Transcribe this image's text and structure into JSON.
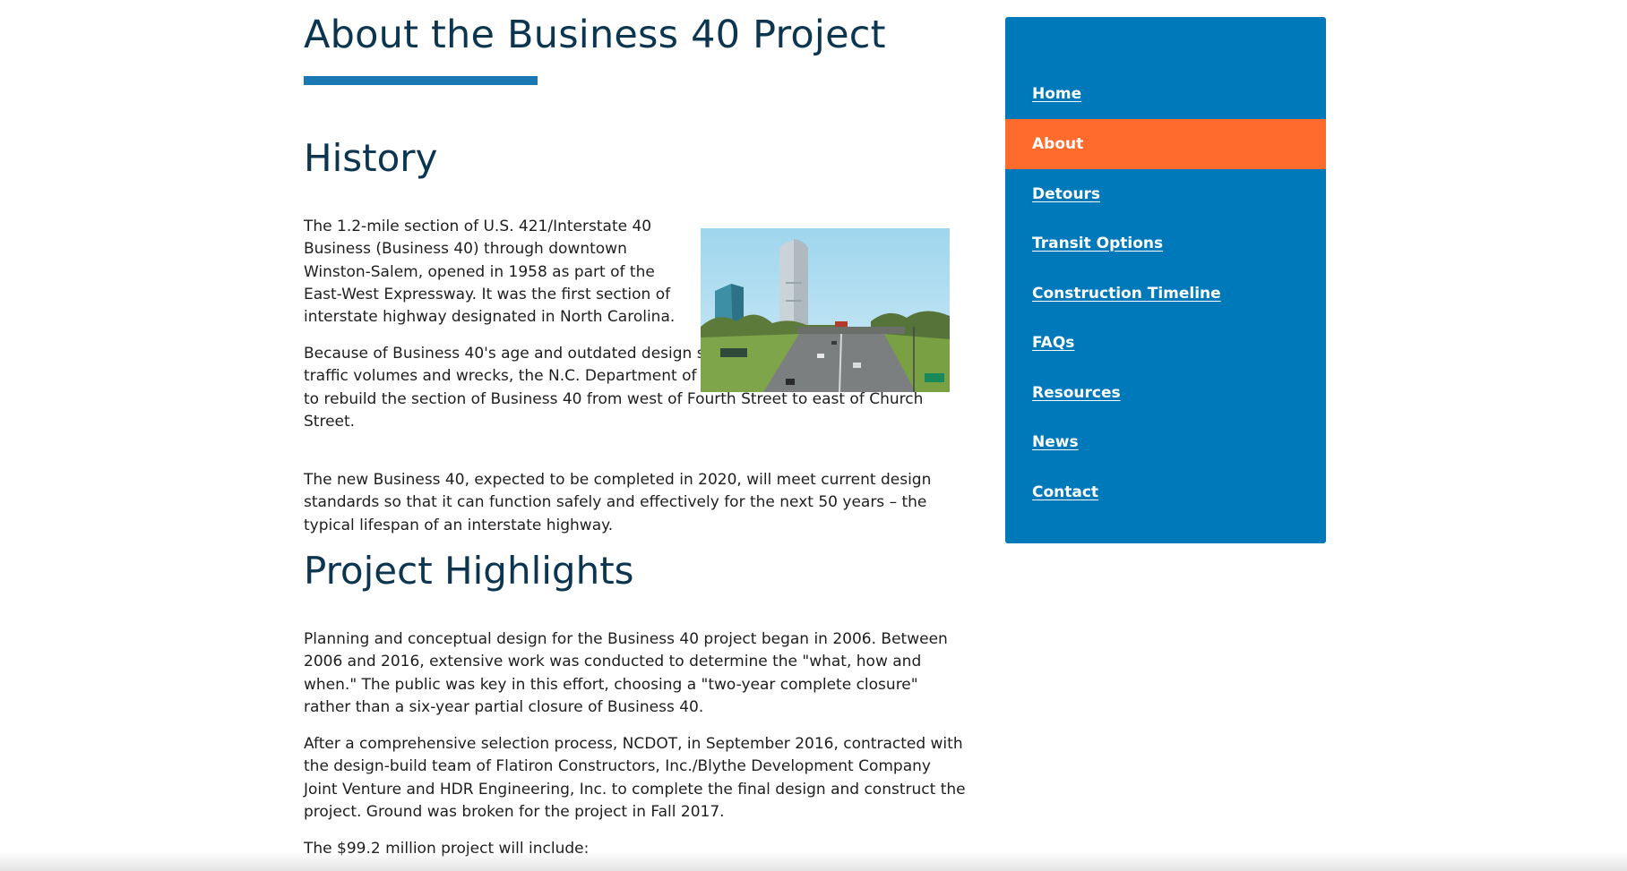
{
  "page": {
    "title": "About the Business 40 Project"
  },
  "sections": {
    "history": {
      "heading": "History",
      "p1": "The 1.2-mile section of U.S. 421/Interstate 40 Business (Business 40) through downtown Winston-Salem, opened in 1958 as part of the East-West Expressway. It was the first section of interstate highway designated in North Carolina.",
      "p2": "Because of Business 40's age and outdated design standards, as well as increasing traffic volumes and wrecks, the N.C. Department of Transportation decided in 2006 to rebuild the section of Business 40 from west of Fourth Street to east of Church Street.",
      "p3": "The new Business 40, expected to be completed in 2020, will meet current design standards so that it can function safely and effectively for the next 50 years – the typical lifespan of an interstate highway."
    },
    "highlights": {
      "heading": "Project Highlights",
      "p1": "Planning and conceptual design for the Business 40 project began in 2006. Between 2006 and 2016, extensive work was conducted to determine the \"what, how and when.\" The public was key in this effort, choosing a \"two-year complete closure\" rather than a six-year partial closure of Business 40.",
      "p2": "After a comprehensive selection process, NCDOT, in September 2016, contracted with the design-build team of Flatiron Constructors, Inc./Blythe Development Company Joint Venture and HDR Engineering, Inc. to complete the final design and construct the project. Ground was broken for the project in Fall 2017.",
      "p3": "The $99.2 million project will include:"
    }
  },
  "nav": {
    "items": [
      {
        "label": "Home"
      },
      {
        "label": "About"
      },
      {
        "label": "Detours"
      },
      {
        "label": "Transit Options"
      },
      {
        "label": "Construction Timeline"
      },
      {
        "label": "FAQs"
      },
      {
        "label": "Resources"
      },
      {
        "label": "News"
      },
      {
        "label": "Contact"
      }
    ],
    "active": "About"
  },
  "colors": {
    "nav_bg": "#0079bb",
    "nav_active": "#ff6b2c",
    "heading": "#0c3550",
    "title_rule": "#1a78b4"
  }
}
